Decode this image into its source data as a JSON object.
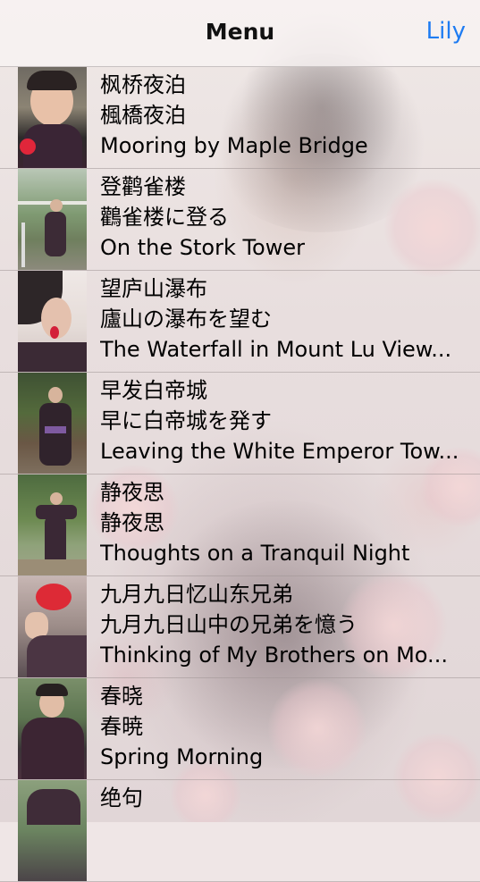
{
  "navbar": {
    "title": "Menu",
    "right_label": "Lily"
  },
  "poems": [
    {
      "chinese": "枫桥夜泊",
      "japanese": "楓橋夜泊",
      "english": "Mooring by Maple Bridge"
    },
    {
      "chinese": "登鹳雀楼",
      "japanese": "鸛雀楼に登る",
      "english": "On the Stork Tower"
    },
    {
      "chinese": "望庐山瀑布",
      "japanese": "廬山の瀑布を望む",
      "english": "The Waterfall in Mount Lu View..."
    },
    {
      "chinese": "早发白帝城",
      "japanese": "早に白帝城を発す",
      "english": "Leaving the White Emperor Tow..."
    },
    {
      "chinese": "静夜思",
      "japanese": "静夜思",
      "english": "Thoughts on a Tranquil Night"
    },
    {
      "chinese": "九月九日忆山东兄弟",
      "japanese": "九月九日山中の兄弟を憶う",
      "english": "Thinking of My Brothers on Mo..."
    },
    {
      "chinese": "春晓",
      "japanese": "春暁",
      "english": "Spring Morning"
    },
    {
      "chinese": "绝句",
      "japanese": "",
      "english": ""
    }
  ]
}
